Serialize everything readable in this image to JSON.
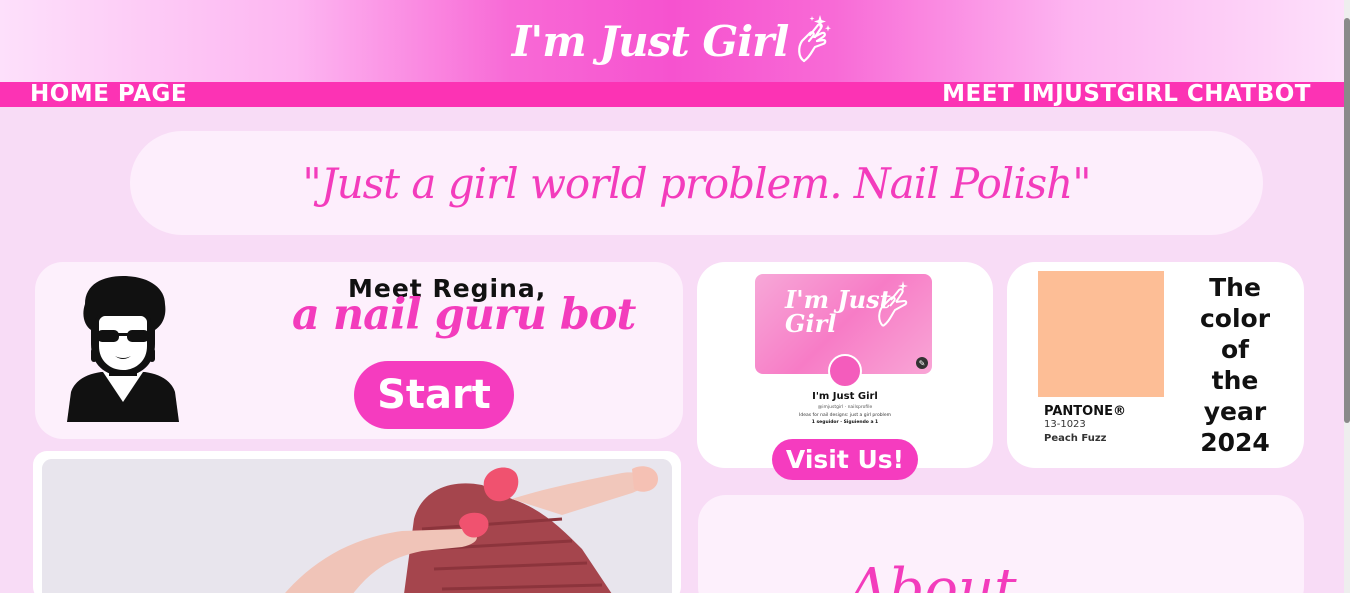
{
  "header": {
    "logo_text": "I'm Just Girl",
    "logo_icon": "finger-heart-sparkle-icon"
  },
  "nav": {
    "home": "HOME PAGE",
    "chatbot": "MEET IMJUSTGIRL CHATBOT"
  },
  "quote": "\"Just a girl world problem. Nail Polish\"",
  "regina": {
    "meet": "Meet Regina,",
    "subtitle": "a nail guru bot",
    "start_label": "Start",
    "avatar_icon": "woman-sunglasses-icon"
  },
  "pinterest": {
    "banner_text": "I'm Just Girl",
    "profile_name": "I'm Just Girl",
    "handle": "@imjustgirl · nailsprofile",
    "bio": "Ideas for nail designs: just a girl problem",
    "follow_stats": "1 seguidor · Siguiendo a 1",
    "visit_label": "Visit Us!"
  },
  "pantone": {
    "brand": "PANTONE®",
    "code": "13-1023",
    "name": "Peach Fuzz",
    "swatch_color": "#fdbe96",
    "caption_lines": [
      "The",
      "color",
      "of",
      "the",
      "year",
      "2024"
    ]
  },
  "about": {
    "heading": "About"
  },
  "colors": {
    "accent": "#f53cbf",
    "nav_bar": "#fc33b4",
    "page_bg": "#f8dcf6"
  }
}
